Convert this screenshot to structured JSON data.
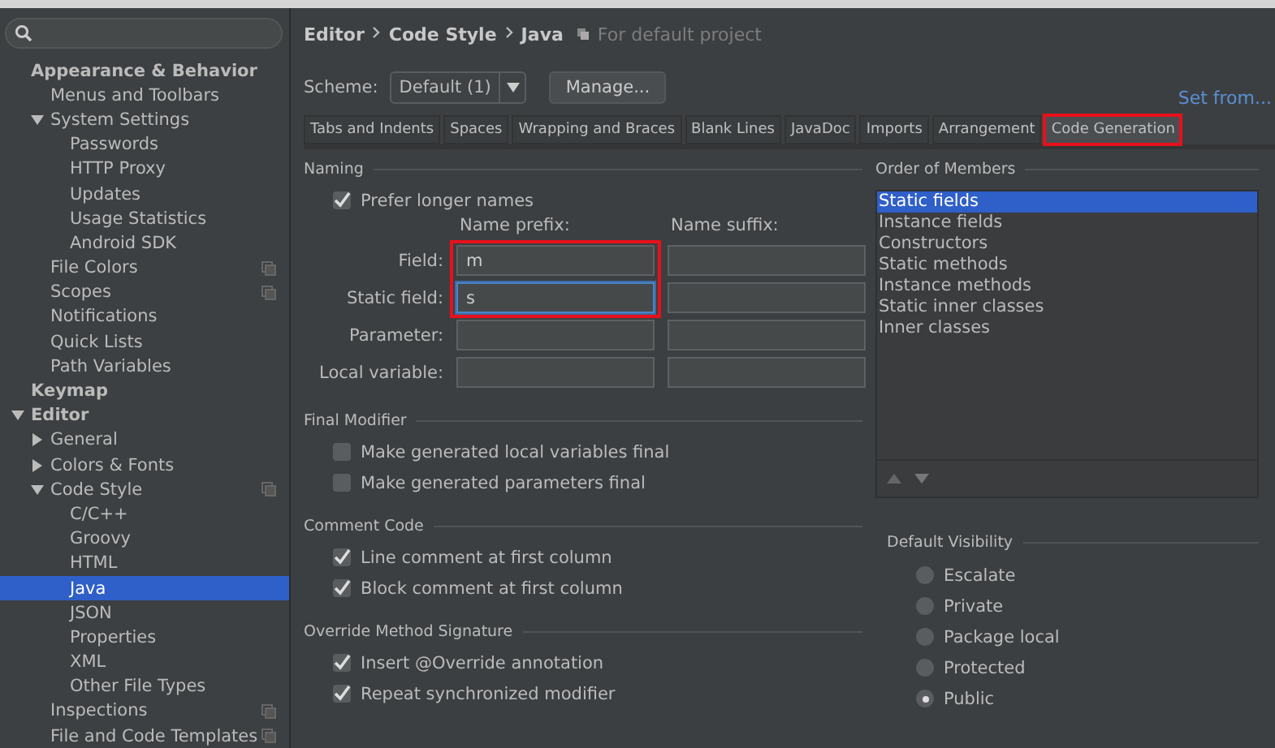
{
  "sidebar": {
    "tree": [
      {
        "label": "Appearance & Behavior",
        "selected": false,
        "children": [
          {
            "label": "Menus and Toolbars",
            "selected": false
          },
          {
            "label": "System Settings",
            "selected": false,
            "expanded": true,
            "children": [
              {
                "label": "Passwords",
                "selected": false
              },
              {
                "label": "HTTP Proxy",
                "selected": false
              },
              {
                "label": "Updates",
                "selected": false
              },
              {
                "label": "Usage Statistics",
                "selected": false
              },
              {
                "label": "Android SDK",
                "selected": false
              }
            ]
          },
          {
            "label": "File Colors",
            "selected": false,
            "project_level": true
          },
          {
            "label": "Scopes",
            "selected": false,
            "project_level": true
          },
          {
            "label": "Notifications",
            "selected": false
          },
          {
            "label": "Quick Lists",
            "selected": false
          },
          {
            "label": "Path Variables",
            "selected": false
          }
        ]
      },
      {
        "label": "Keymap",
        "selected": false
      },
      {
        "label": "Editor",
        "selected": false,
        "expanded": true,
        "children": [
          {
            "label": "General",
            "selected": false,
            "expanded": false
          },
          {
            "label": "Colors & Fonts",
            "selected": false,
            "expanded": false
          },
          {
            "label": "Code Style",
            "selected": false,
            "expanded": true,
            "project_level": true,
            "children": [
              {
                "label": "C/C++",
                "selected": false
              },
              {
                "label": "Groovy",
                "selected": false
              },
              {
                "label": "HTML",
                "selected": false
              },
              {
                "label": "Java",
                "selected": true
              },
              {
                "label": "JSON",
                "selected": false
              },
              {
                "label": "Properties",
                "selected": false
              },
              {
                "label": "XML",
                "selected": false
              },
              {
                "label": "Other File Types",
                "selected": false
              }
            ]
          },
          {
            "label": "Inspections",
            "selected": false,
            "project_level": true
          },
          {
            "label": "File and Code Templates",
            "selected": false,
            "project_level": true
          }
        ]
      }
    ]
  },
  "breadcrumb": {
    "path": [
      "Editor",
      "Code Style",
      "Java"
    ],
    "note": "For default project"
  },
  "scheme": {
    "label": "Scheme:",
    "value": "Default (1)",
    "manage_button": "Manage...",
    "set_from_link": "Set from..."
  },
  "tabs": [
    {
      "label": "Tabs and Indents",
      "selected": false,
      "highlighted": false
    },
    {
      "label": "Spaces",
      "selected": false,
      "highlighted": false
    },
    {
      "label": "Wrapping and Braces",
      "selected": false,
      "highlighted": false
    },
    {
      "label": "Blank Lines",
      "selected": false,
      "highlighted": false
    },
    {
      "label": "JavaDoc",
      "selected": false,
      "highlighted": false
    },
    {
      "label": "Imports",
      "selected": false,
      "highlighted": false
    },
    {
      "label": "Arrangement",
      "selected": false,
      "highlighted": false
    },
    {
      "label": "Code Generation",
      "selected": true,
      "highlighted": true
    }
  ],
  "naming": {
    "title": "Naming",
    "prefer_longer": {
      "label": "Prefer longer names",
      "checked": true
    },
    "prefix_header": "Name prefix:",
    "suffix_header": "Name suffix:",
    "rows": [
      {
        "label": "Field:",
        "prefix": "m",
        "suffix": "",
        "focused": false,
        "highlighted": true
      },
      {
        "label": "Static field:",
        "prefix": "s",
        "suffix": "",
        "focused": true,
        "highlighted": true
      },
      {
        "label": "Parameter:",
        "prefix": "",
        "suffix": "",
        "focused": false
      },
      {
        "label": "Local variable:",
        "prefix": "",
        "suffix": "",
        "focused": false
      }
    ]
  },
  "sections": [
    {
      "title": "Final Modifier",
      "options": [
        {
          "label": "Make generated local variables final",
          "checked": false
        },
        {
          "label": "Make generated parameters final",
          "checked": false
        }
      ]
    },
    {
      "title": "Comment Code",
      "options": [
        {
          "label": "Line comment at first column",
          "checked": true
        },
        {
          "label": "Block comment at first column",
          "checked": true
        }
      ]
    },
    {
      "title": "Override Method Signature",
      "options": [
        {
          "label": "Insert @Override annotation",
          "checked": true
        },
        {
          "label": "Repeat synchronized modifier",
          "checked": true
        }
      ]
    }
  ],
  "order_of_members": {
    "title": "Order of Members",
    "items": [
      {
        "label": "Static fields",
        "selected": true
      },
      {
        "label": "Instance fields",
        "selected": false
      },
      {
        "label": "Constructors",
        "selected": false
      },
      {
        "label": "Static methods",
        "selected": false
      },
      {
        "label": "Instance methods",
        "selected": false
      },
      {
        "label": "Static inner classes",
        "selected": false
      },
      {
        "label": "Inner classes",
        "selected": false
      }
    ]
  },
  "default_visibility": {
    "title": "Default Visibility",
    "options": [
      {
        "label": "Escalate",
        "selected": false
      },
      {
        "label": "Private",
        "selected": false
      },
      {
        "label": "Package local",
        "selected": false
      },
      {
        "label": "Protected",
        "selected": false
      },
      {
        "label": "Public",
        "selected": true
      }
    ]
  }
}
